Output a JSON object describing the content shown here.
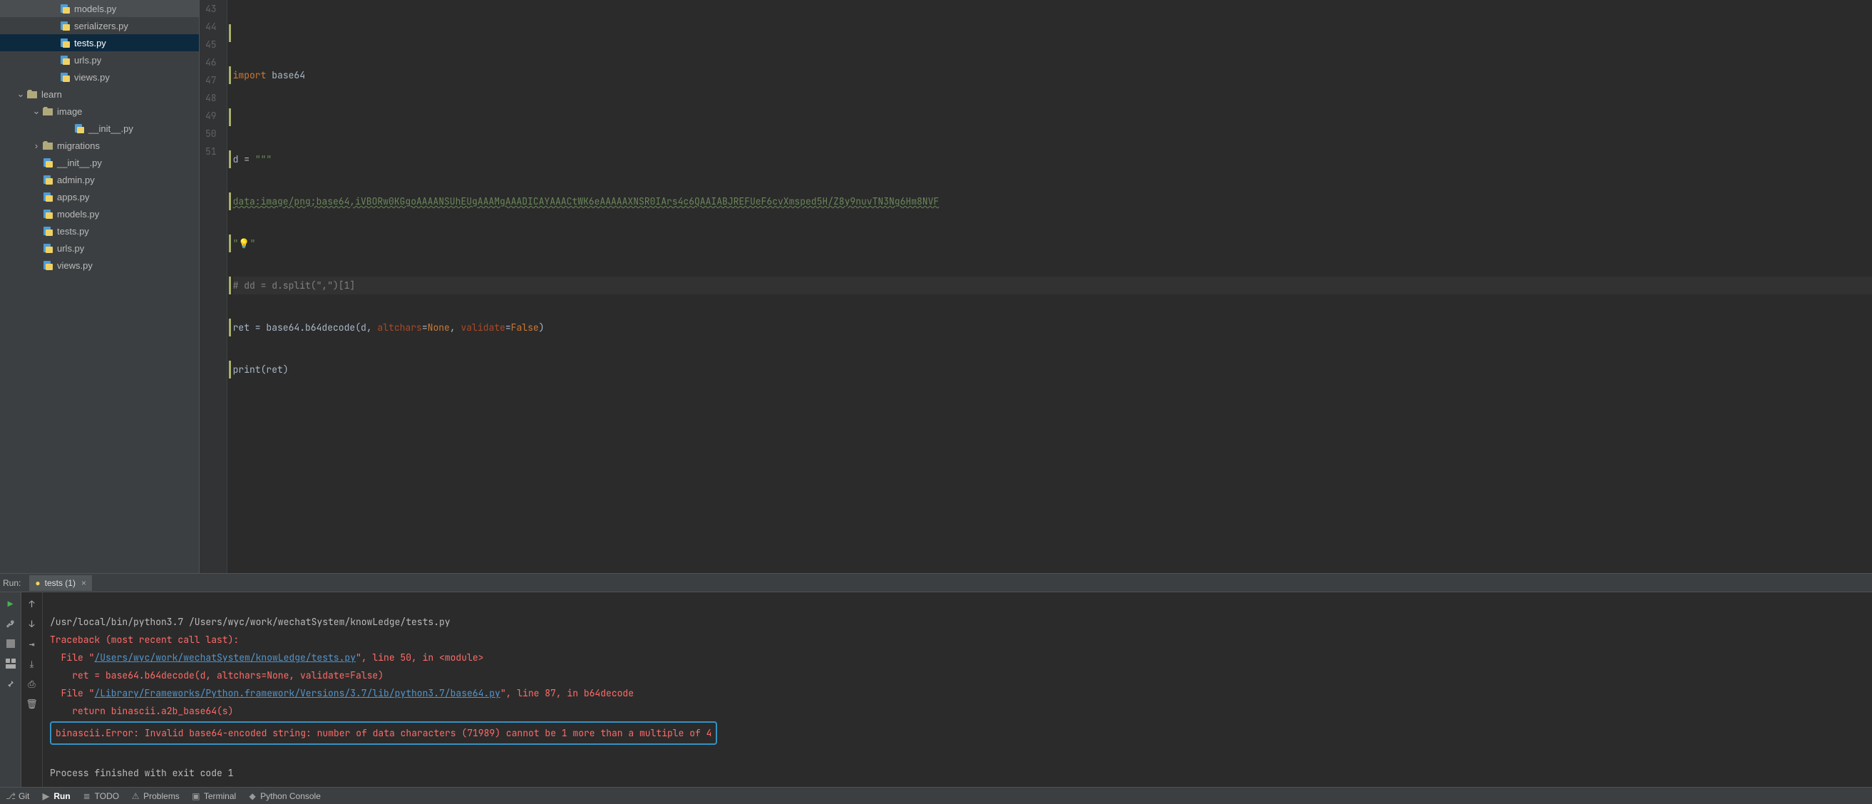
{
  "sidebar": {
    "items": [
      {
        "label": "models.py",
        "pad": 68,
        "type": "py",
        "sel": false,
        "chev": ""
      },
      {
        "label": "serializers.py",
        "pad": 68,
        "type": "py",
        "sel": false,
        "chev": ""
      },
      {
        "label": "tests.py",
        "pad": 68,
        "type": "py",
        "sel": true,
        "chev": ""
      },
      {
        "label": "urls.py",
        "pad": 68,
        "type": "py",
        "sel": false,
        "chev": ""
      },
      {
        "label": "views.py",
        "pad": 68,
        "type": "py",
        "sel": false,
        "chev": ""
      },
      {
        "label": "learn",
        "pad": 22,
        "type": "folder",
        "sel": false,
        "chev": "v"
      },
      {
        "label": "image",
        "pad": 44,
        "type": "folder",
        "sel": false,
        "chev": "v"
      },
      {
        "label": "__init__.py",
        "pad": 88,
        "type": "py",
        "sel": false,
        "chev": ""
      },
      {
        "label": "migrations",
        "pad": 44,
        "type": "folder",
        "sel": false,
        "chev": ">"
      },
      {
        "label": "__init__.py",
        "pad": 44,
        "type": "py",
        "sel": false,
        "chev": ""
      },
      {
        "label": "admin.py",
        "pad": 44,
        "type": "py",
        "sel": false,
        "chev": ""
      },
      {
        "label": "apps.py",
        "pad": 44,
        "type": "py",
        "sel": false,
        "chev": ""
      },
      {
        "label": "models.py",
        "pad": 44,
        "type": "py",
        "sel": false,
        "chev": ""
      },
      {
        "label": "tests.py",
        "pad": 44,
        "type": "py",
        "sel": false,
        "chev": ""
      },
      {
        "label": "urls.py",
        "pad": 44,
        "type": "py",
        "sel": false,
        "chev": ""
      },
      {
        "label": "views.py",
        "pad": 44,
        "type": "py",
        "sel": false,
        "chev": ""
      }
    ]
  },
  "editor": {
    "first_line_no": 43,
    "lines": {
      "l43": "",
      "l44_import": "import",
      "l44_mod": " base64",
      "l45": "",
      "l46_pre": "d = ",
      "l46_str": "\"\"\"",
      "l47": "data:image/png;base64,iVBORw0KGgoAAAANSUhEUgAAAMgAAADICAYAAACtWK6eAAAAAXNSR0IArs4c6QAAIABJREFUeF6cvXmsped5H/Z8y9nuvTN3Ng6Hm8NVF",
      "l48_str": "\"",
      "l48_bulb": "💡",
      "l48_str2": "\"",
      "l49": "# dd = d.split(\",\")[1]",
      "l50_a": "ret = base64.b64decode(d",
      "l50_b": ", ",
      "l50_arg1": "altchars",
      "l50_eq": "=",
      "l50_none": "None",
      "l50_c": ", ",
      "l50_arg2": "validate",
      "l50_false": "False",
      "l50_d": ")",
      "l51_a": "print",
      "l51_b": "(ret)"
    },
    "line_nos": [
      "43",
      "44",
      "45",
      "46",
      "47",
      "48",
      "49",
      "50",
      "51"
    ]
  },
  "run": {
    "panel_title": "Run:",
    "tab_name": "tests (1)",
    "console": {
      "cmd": "/usr/local/bin/python3.7 /Users/wyc/work/wechatSystem/knowLedge/tests.py",
      "trace_header": "Traceback (most recent call last):",
      "f1_pre": "  File \"",
      "f1_link": "/Users/wyc/work/wechatSystem/knowLedge/tests.py",
      "f1_post": "\", line 50, in <module>",
      "f1_code": "    ret = base64.b64decode(d, altchars=None, validate=False)",
      "f2_pre": "  File \"",
      "f2_link": "/Library/Frameworks/Python.framework/Versions/3.7/lib/python3.7/base64.py",
      "f2_post": "\", line 87, in b64decode",
      "f2_code": "    return binascii.a2b_base64(s)",
      "error": "binascii.Error: Invalid base64-encoded string: number of data characters (71989) cannot be 1 more than a multiple of 4",
      "exit": "Process finished with exit code 1"
    }
  },
  "bottombar": {
    "git": "Git",
    "run": "Run",
    "todo": "TODO",
    "problems": "Problems",
    "terminal": "Terminal",
    "pyconsole": "Python Console"
  }
}
